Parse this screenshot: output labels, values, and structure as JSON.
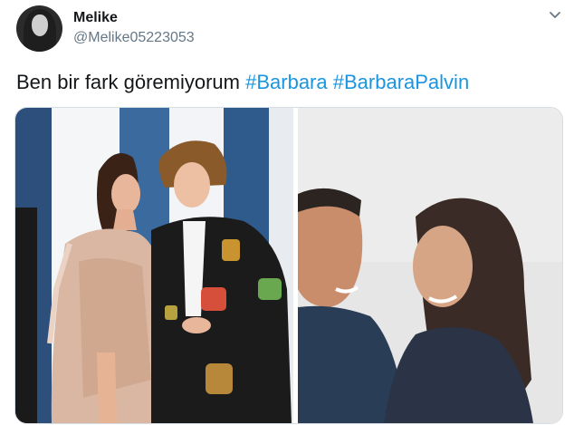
{
  "tweet": {
    "author": {
      "display_name": "Melike",
      "handle": "@Melike05223053"
    },
    "text": "Ben bir fark göremiyorum",
    "hashtags": [
      "#Barbara",
      "#BarbaraPalvin"
    ]
  },
  "icons": {
    "avatar": "profile-avatar",
    "more": "chevron-down-icon"
  },
  "colors": {
    "hashtag": "#1b95e0",
    "handle": "#657786",
    "text": "#14171a"
  }
}
